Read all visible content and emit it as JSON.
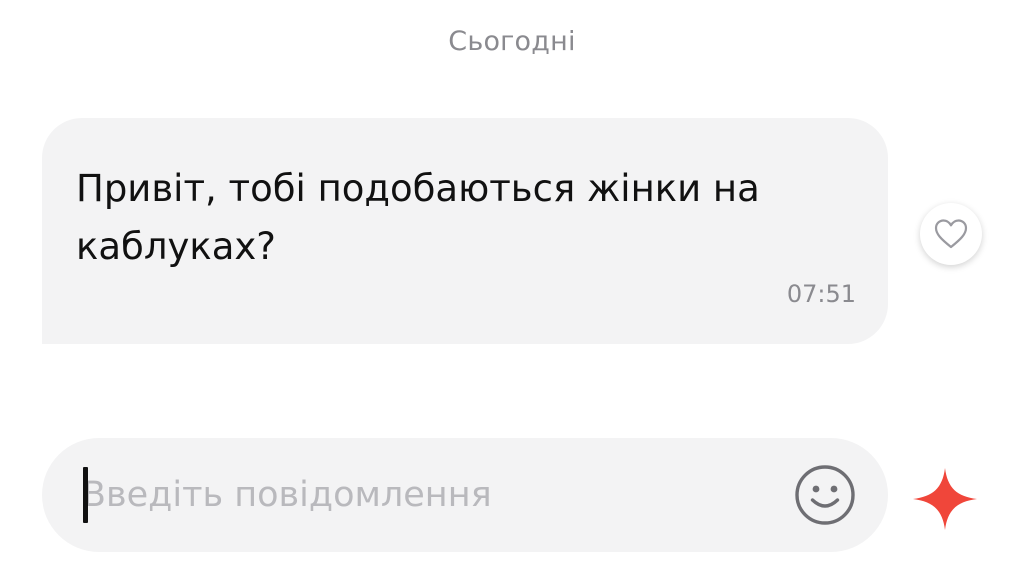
{
  "chat": {
    "date_divider": "Сьогодні",
    "messages": [
      {
        "text": "Привіт, тобі подобаються жінки на каблуках?",
        "time": "07:51",
        "reaction_icon": "heart-outline-icon"
      }
    ]
  },
  "composer": {
    "placeholder": "Введіть повідомлення",
    "value": "",
    "emoji_icon": "smiley-icon",
    "action_icon": "sparkle-icon"
  },
  "colors": {
    "bubble_bg": "#f3f3f4",
    "meta_text": "#8a8a8f",
    "placeholder": "#b9b9bd",
    "accent": "#f0463a"
  }
}
